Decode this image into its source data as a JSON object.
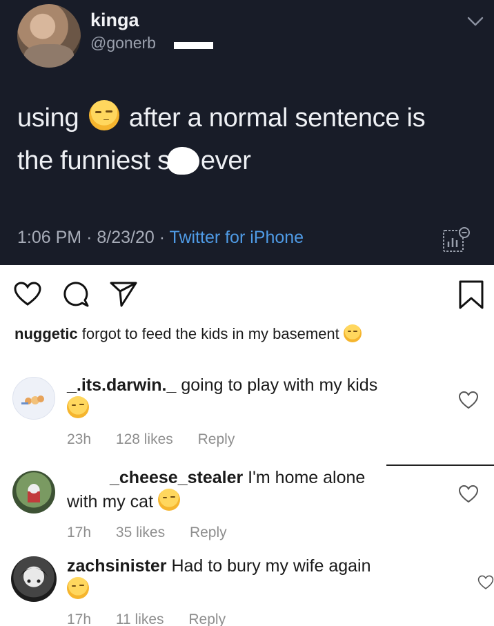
{
  "tweet": {
    "display_name": "kinga",
    "handle": "@gonerb",
    "text_part1": "using",
    "text_part2": "after a normal sentence is",
    "text_part3": "the funniest s",
    "text_part4": "ever",
    "time": "1:06 PM",
    "date": "8/23/20",
    "separator": "·",
    "source": "Twitter for iPhone",
    "colors": {
      "background": "#181c28",
      "source_link": "#4f9be6"
    }
  },
  "post_actions": {
    "icons": [
      "heart-icon",
      "comment-icon",
      "share-icon",
      "bookmark-icon"
    ]
  },
  "caption": {
    "username": "nuggetic",
    "text": "forgot to feed the kids in my basement"
  },
  "comments": [
    {
      "username": "_.its.darwin._",
      "text": "going to play with my kids",
      "age": "23h",
      "likes": "128 likes",
      "reply": "Reply"
    },
    {
      "username": "_cheese_stealer",
      "text_line1": "I'm home alone",
      "text_line2": "with my cat",
      "age": "17h",
      "likes": "35 likes",
      "reply": "Reply"
    },
    {
      "username": "zachsinister",
      "text": "Had to bury my wife again",
      "age": "17h",
      "likes": "11 likes",
      "reply": "Reply"
    }
  ]
}
